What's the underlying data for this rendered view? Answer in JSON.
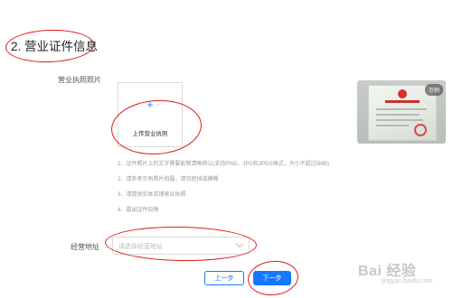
{
  "section": {
    "title": "2. 营业证件信息"
  },
  "license": {
    "label": "营业执照照片",
    "upload_icon": "+",
    "upload_text": "上传营业执照",
    "example_badge": "示例",
    "notes": [
      "1、证件照片上的文字需要能够清晰辨认(支持PNG、JPG和JPEG格式，大小不超过5MB)",
      "2、请参考示例照片拍摄，请勿遮挡或模糊",
      "3、请提供实体店铺营业执照",
      "4、露出证件四角"
    ]
  },
  "address": {
    "label": "经营地址",
    "placeholder": "请选择经营地址"
  },
  "actions": {
    "prev_label": "上一步",
    "next_label": "下一步"
  },
  "watermark": {
    "main": "Bai 经验",
    "sub": "jingyan.baidu.com"
  },
  "colors": {
    "primary": "#1677ff",
    "annotation": "#e01818",
    "placeholder": "#bbbbbb"
  }
}
